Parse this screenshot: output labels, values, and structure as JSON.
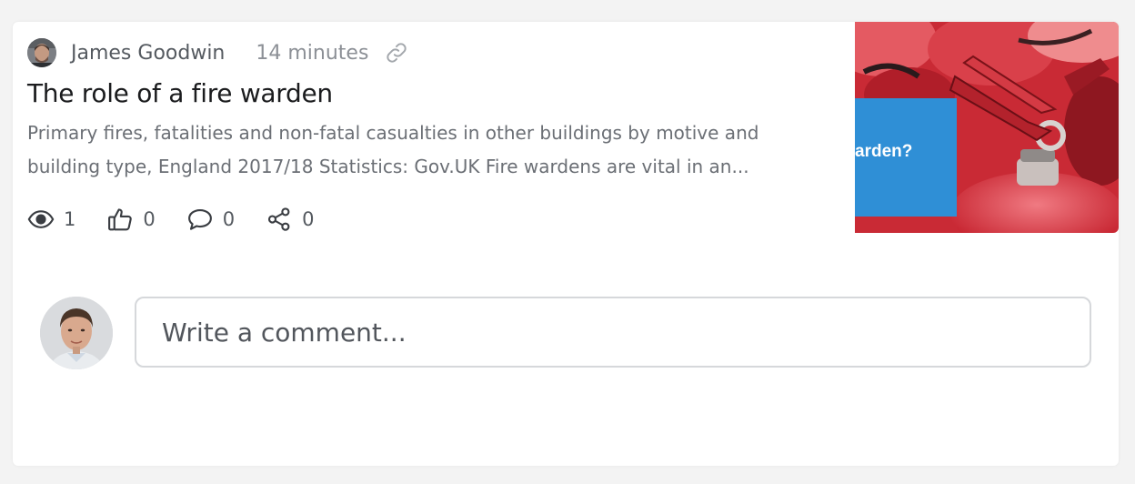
{
  "post": {
    "author": "James Goodwin",
    "time": "14 minutes",
    "title": "The role of a fire warden",
    "excerpt_line1": "Primary fires, fatalities and non-fatal casualties in other buildings by motive and",
    "excerpt_line2": "building type, England 2017/18 Statistics: Gov.UK Fire wardens are vital in an...",
    "thumbnail_text": "arden?",
    "stats": {
      "views": "1",
      "likes": "0",
      "comments": "0",
      "shares": "0"
    }
  },
  "comment": {
    "placeholder": "Write a comment..."
  },
  "colors": {
    "card_background": "#ffffff",
    "page_background": "#f3f3f3",
    "thumbnail_accent": "#2f8fd6",
    "thumbnail_red": "#d8323c"
  },
  "icons": [
    "link-icon",
    "eye-icon",
    "thumbs-up-icon",
    "comment-icon",
    "share-icon"
  ]
}
